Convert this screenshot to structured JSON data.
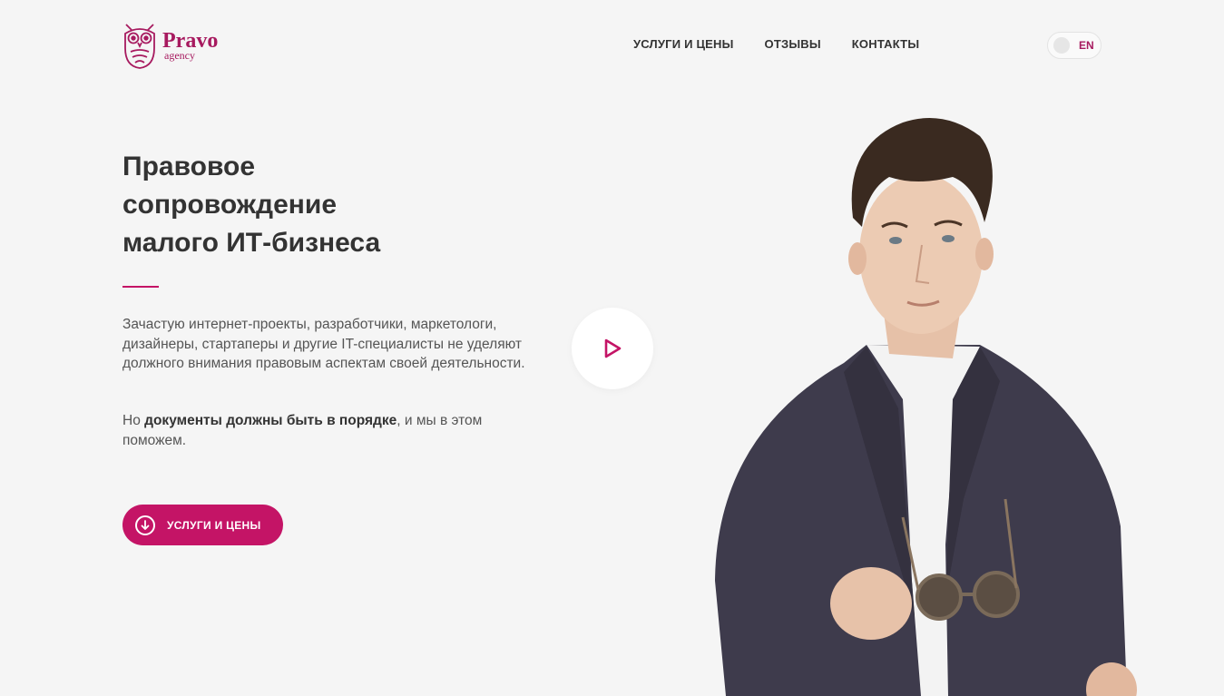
{
  "brand": {
    "name": "Pravo",
    "sub": "agency",
    "color": "#a71a5f"
  },
  "nav": {
    "items": [
      {
        "label": "УСЛУГИ И ЦЕНЫ"
      },
      {
        "label": "ОТЗЫВЫ"
      },
      {
        "label": "КОНТАКТЫ"
      }
    ]
  },
  "lang": {
    "current": "EN"
  },
  "hero": {
    "title_lines": [
      "Правовое",
      "сопровождение",
      "малого ИТ-бизнеса"
    ],
    "description": "Зачастую интернет-проекты, разработчики, маркетологи, дизайнеры, стартаперы и другие IT-специалисты не уделяют должного внимания правовым аспектам своей деятельности.",
    "note_pre": "Но ",
    "note_bold": "документы должны быть в порядке",
    "note_post": ", и мы в этом поможем.",
    "cta_label": "УСЛУГИ И ЦЕНЫ"
  },
  "icons": {
    "logo": "owl-logo-icon",
    "play": "play-icon",
    "cta": "arrow-down-circle-icon"
  },
  "colors": {
    "accent": "#c41466",
    "background": "#f5f5f5",
    "text": "#333333"
  }
}
